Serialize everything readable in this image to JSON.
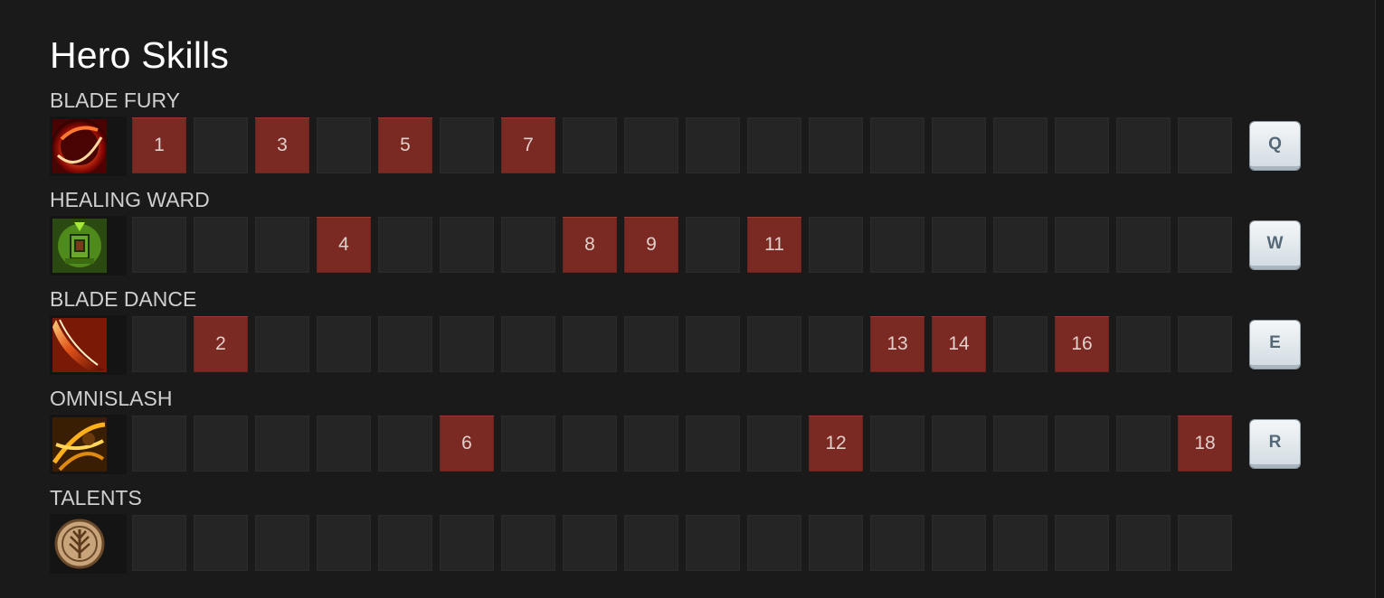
{
  "title": "Hero Skills",
  "colors": {
    "background": "#1a1a1a",
    "cell_empty": "#252525",
    "cell_learned": "#7a2a22",
    "key_face": "#e6edf1"
  },
  "skills": [
    {
      "name": "BLADE FURY",
      "icon": "blade-fury-icon",
      "hotkey": "Q",
      "levels": [
        "1",
        "",
        "3",
        "",
        "5",
        "",
        "7",
        "",
        "",
        "",
        "",
        "",
        "",
        "",
        "",
        "",
        "",
        ""
      ]
    },
    {
      "name": "HEALING WARD",
      "icon": "healing-ward-icon",
      "hotkey": "W",
      "levels": [
        "",
        "",
        "",
        "4",
        "",
        "",
        "",
        "8",
        "9",
        "",
        "11",
        "",
        "",
        "",
        "",
        "",
        "",
        ""
      ]
    },
    {
      "name": "BLADE DANCE",
      "icon": "blade-dance-icon",
      "hotkey": "E",
      "levels": [
        "",
        "2",
        "",
        "",
        "",
        "",
        "",
        "",
        "",
        "",
        "",
        "",
        "13",
        "14",
        "",
        "16",
        "",
        ""
      ]
    },
    {
      "name": "OMNISLASH",
      "icon": "omnislash-icon",
      "hotkey": "R",
      "levels": [
        "",
        "",
        "",
        "",
        "",
        "6",
        "",
        "",
        "",
        "",
        "",
        "12",
        "",
        "",
        "",
        "",
        "",
        "18"
      ]
    },
    {
      "name": "TALENTS",
      "icon": "talent-tree-icon",
      "hotkey": "",
      "levels": [
        "",
        "",
        "",
        "",
        "",
        "",
        "",
        "",
        "",
        "",
        "",
        "",
        "",
        "",
        "",
        "",
        "",
        ""
      ]
    }
  ]
}
